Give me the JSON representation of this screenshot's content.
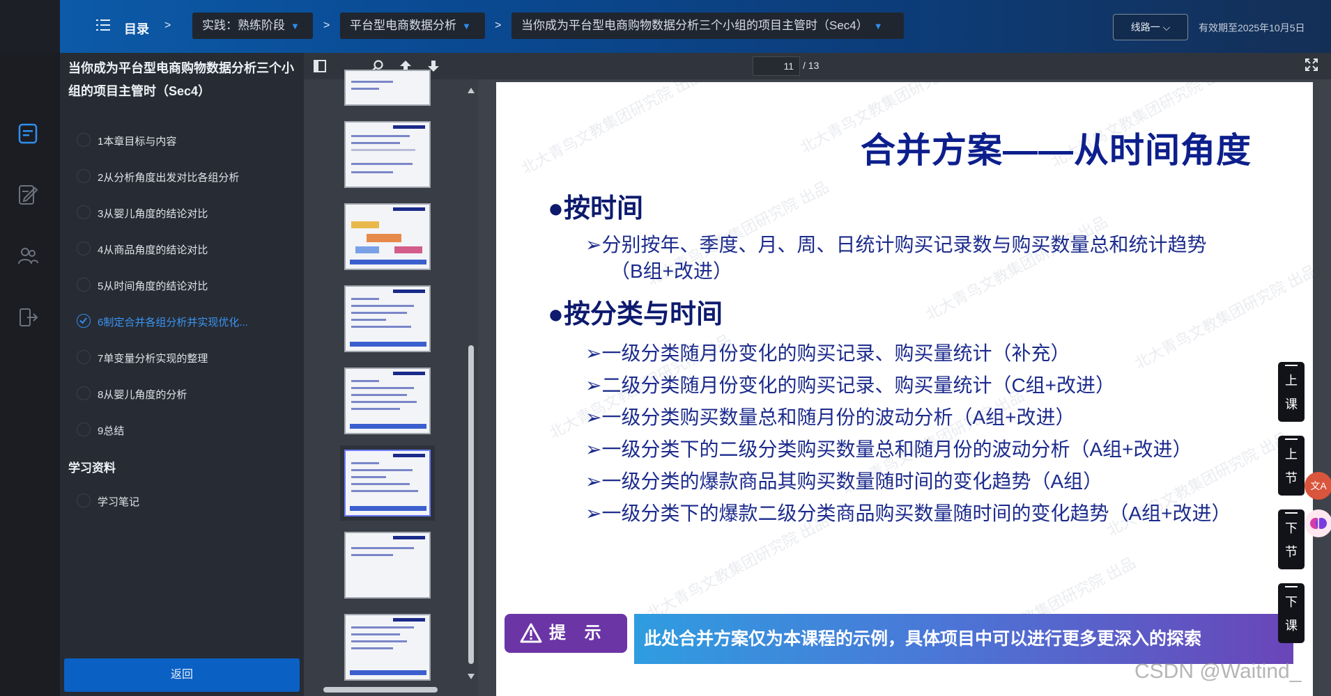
{
  "header": {
    "toc_label": "目录",
    "breadcrumb": [
      {
        "label": "实践：熟练阶段"
      },
      {
        "label": "平台型电商数据分析"
      },
      {
        "label": "当你成为平台型电商购物数据分析三个小组的项目主管时（Sec4）"
      }
    ],
    "separator": ">",
    "route_button": "线路一",
    "valid_until": "有效期至2025年10月5日"
  },
  "toc": {
    "title": "当你成为平台型电商购物数据分析三个小组的项目主管时（Sec4）",
    "items": [
      {
        "label": "1本章目标与内容",
        "done": false
      },
      {
        "label": "2从分析角度出发对比各组分析",
        "done": false
      },
      {
        "label": "3从婴儿角度的结论对比",
        "done": false
      },
      {
        "label": "4从商品角度的结论对比",
        "done": false
      },
      {
        "label": "5从时间角度的结论对比",
        "done": false
      },
      {
        "label": "6制定合并各组分析并实现优化...",
        "done": true,
        "active": true
      },
      {
        "label": "7单变量分析实现的整理",
        "done": false
      },
      {
        "label": "8从婴儿角度的分析",
        "done": false
      },
      {
        "label": "9总结",
        "done": false
      }
    ],
    "study_title": "学习资料",
    "study_items": [
      {
        "label": "学习笔记"
      }
    ],
    "back_button": "返回"
  },
  "viewer": {
    "current_page": "11",
    "total_pages": "/ 13"
  },
  "slide": {
    "title": "合并方案——从时间角度",
    "sections": [
      {
        "heading": "●按时间",
        "items": [
          "➢分别按年、季度、月、周、日统计购买记录数与购买数量总和统计趋势",
          "（B组+改进）"
        ]
      },
      {
        "heading": "●按分类与时间",
        "items": [
          "➢一级分类随月份变化的购买记录、购买量统计（补充）",
          "➢二级分类随月份变化的购买记录、购买量统计（C组+改进）",
          "➢一级分类购买数量总和随月份的波动分析（A组+改进）",
          "➢一级分类下的二级分类购买数量总和随月份的波动分析（A组+改进）",
          "➢一级分类的爆款商品其购买数量随时间的变化趋势（A组）",
          "➢一级分类下的爆款二级分类商品购买数量随时间的变化趋势（A组+改进）"
        ]
      }
    ],
    "tip_label": "提 示",
    "tip_text": "此处合并方案仅为本课程的示例，具体项目中可以进行更多更深入的探索",
    "watermark": "北大青鸟文教集团研究院 出品"
  },
  "side_nav": [
    {
      "chars": [
        "上",
        "课"
      ]
    },
    {
      "chars": [
        "上",
        "节"
      ]
    },
    {
      "chars": [
        "下",
        "节"
      ]
    },
    {
      "chars": [
        "下",
        "课"
      ]
    }
  ],
  "fab_translate": "文A",
  "csdn_watermark": "CSDN @Waitind_"
}
